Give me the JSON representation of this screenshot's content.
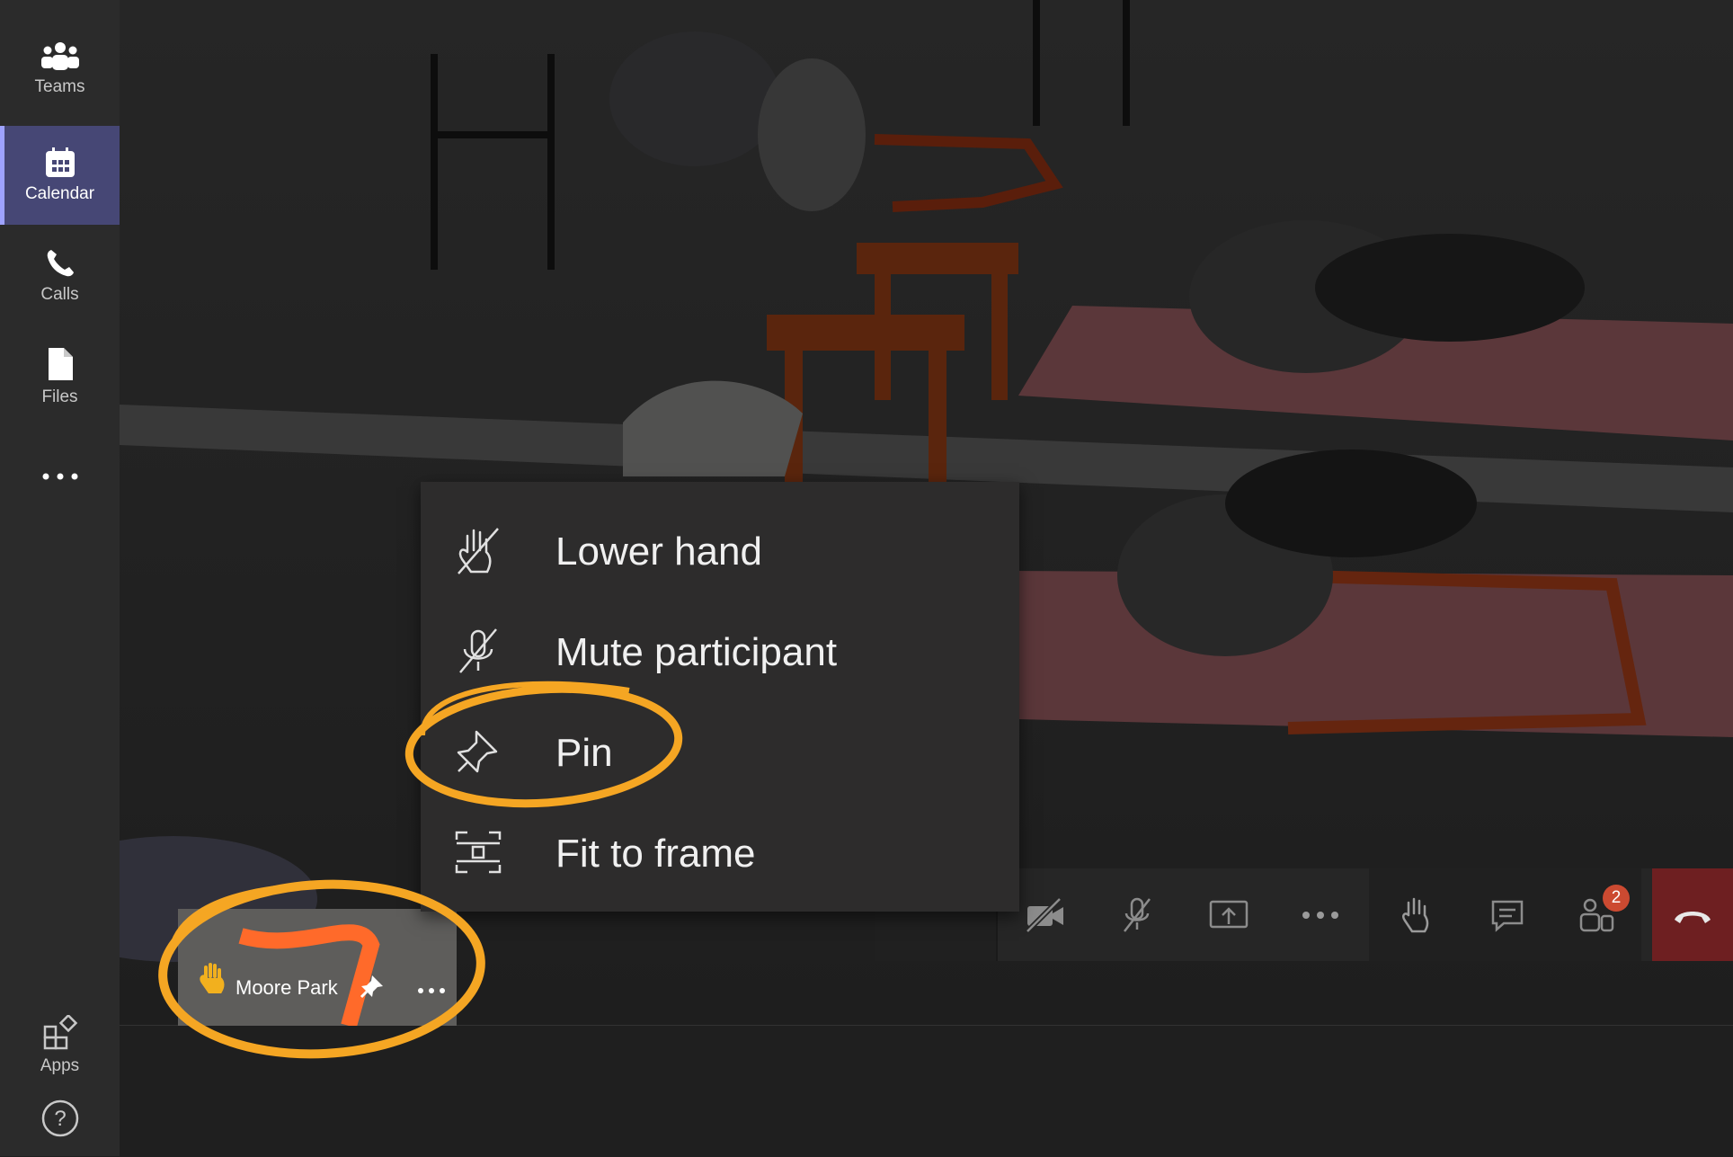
{
  "rail": {
    "items": [
      {
        "label": "Teams",
        "icon": "teams-icon",
        "active": false
      },
      {
        "label": "Calendar",
        "icon": "calendar-icon",
        "active": true
      },
      {
        "label": "Calls",
        "icon": "phone-icon",
        "active": false
      },
      {
        "label": "Files",
        "icon": "file-icon",
        "active": false
      },
      {
        "label": "",
        "icon": "more-icon",
        "active": false
      }
    ],
    "apps_label": "Apps",
    "help_icon": "help-icon"
  },
  "context_menu": {
    "items": [
      {
        "label": "Lower hand",
        "icon": "lower-hand-icon"
      },
      {
        "label": "Mute participant",
        "icon": "mute-icon"
      },
      {
        "label": "Pin",
        "icon": "pin-icon",
        "highlighted": true
      },
      {
        "label": "Fit to frame",
        "icon": "fit-to-frame-icon"
      }
    ]
  },
  "toolbar": {
    "buttons": [
      {
        "name": "camera-off",
        "icon": "camera-off-icon"
      },
      {
        "name": "mic-off",
        "icon": "mic-off-icon"
      },
      {
        "name": "share",
        "icon": "share-screen-icon"
      },
      {
        "name": "more",
        "icon": "more-icon"
      },
      {
        "name": "raise-hand",
        "icon": "hand-icon"
      },
      {
        "name": "chat",
        "icon": "chat-icon"
      },
      {
        "name": "participants",
        "icon": "participants-icon"
      },
      {
        "name": "hang-up",
        "icon": "hang-up-icon"
      }
    ],
    "participants_badge": "2"
  },
  "participant_tile": {
    "name": "Moore Park",
    "hand_icon": "raised-hand-icon",
    "pin_icon": "pin-icon",
    "more_icon": "more-icon"
  },
  "colors": {
    "rail_bg": "#2b2b2b",
    "rail_active": "#464775",
    "menu_bg": "#2d2c2c",
    "annotation": "#f5a623",
    "hangup": "#6e1f21",
    "badge": "#cc4a31"
  }
}
